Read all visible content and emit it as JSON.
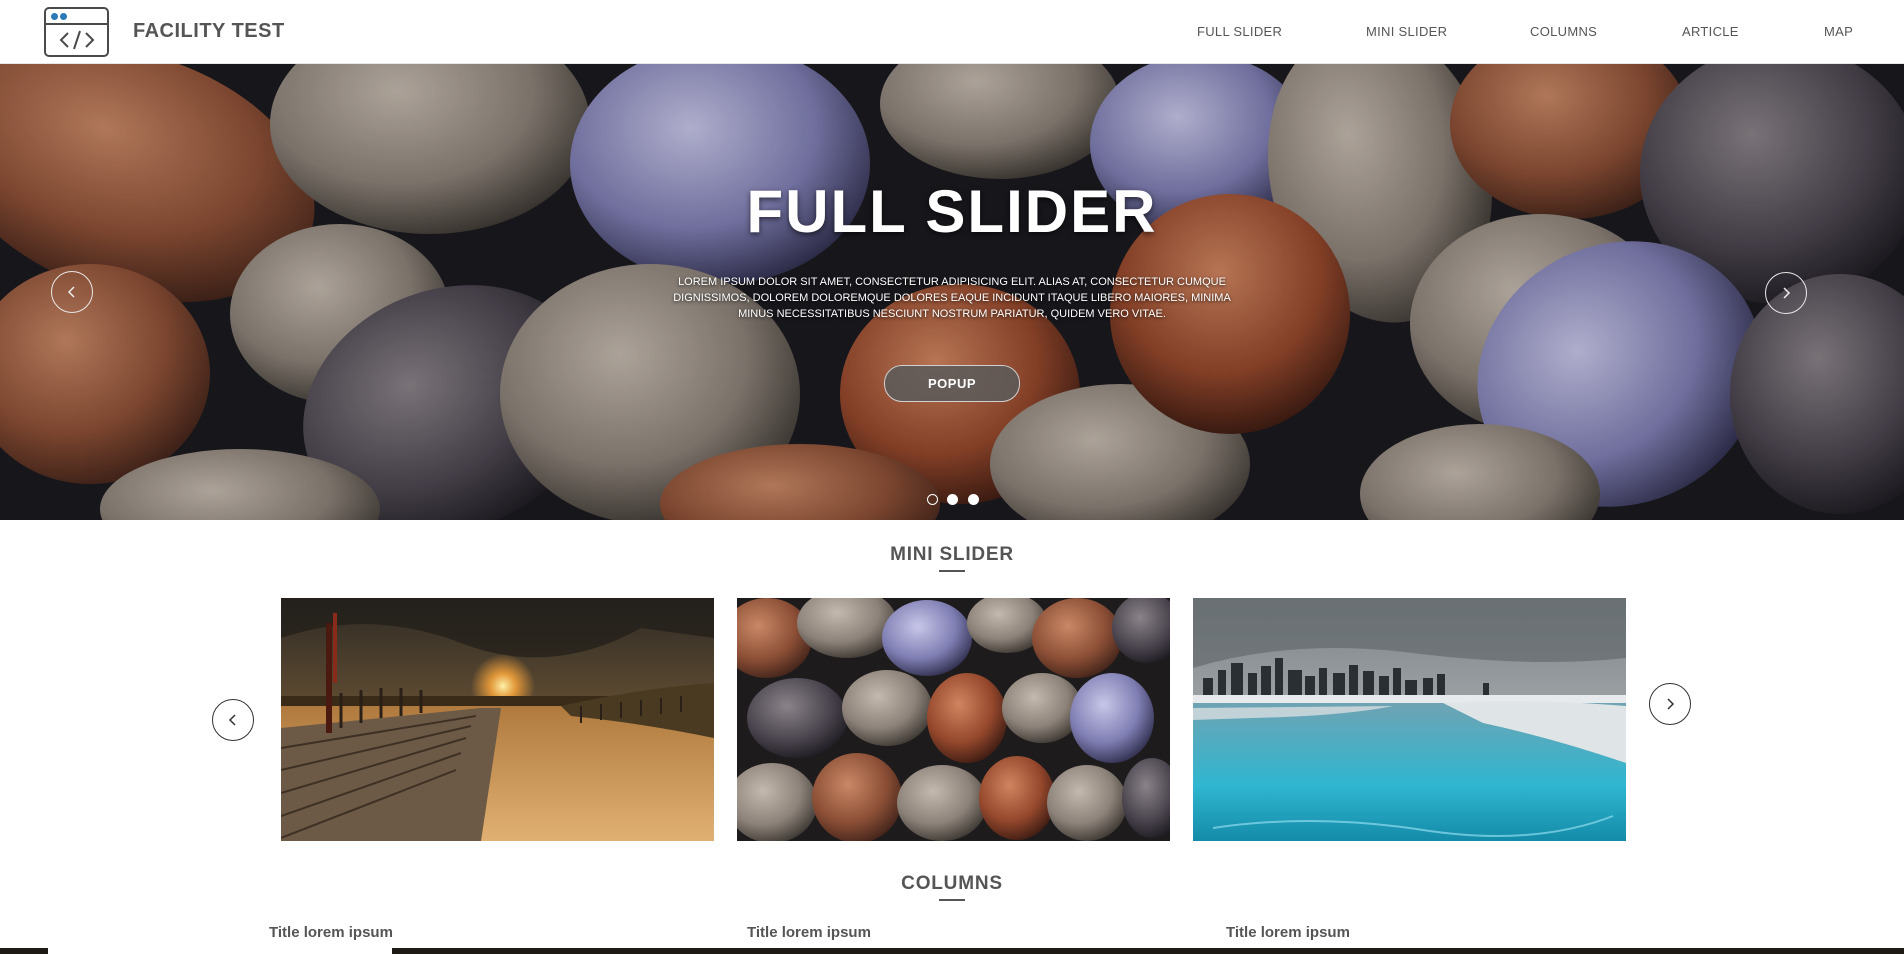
{
  "header": {
    "brand": "FACILITY TEST",
    "logo_icon": "code-window-icon",
    "nav": [
      {
        "label": "FULL SLIDER"
      },
      {
        "label": "MINI SLIDER"
      },
      {
        "label": "COLUMNS"
      },
      {
        "label": "ARTICLE"
      },
      {
        "label": "MAP"
      }
    ]
  },
  "hero": {
    "title": "FULL SLIDER",
    "text": "Lorem ipsum dolor sit amet, consectetur adipisicing elit. Alias at, consectetur cumque dignissimos, dolorem doloremque dolores eaque incidunt itaque libero maiores, minima minus necessitatibus nesciunt nostrum pariatur, quidem vero vitae.",
    "button": "POPUP",
    "prev_icon": "chevron-left-icon",
    "next_icon": "chevron-right-icon",
    "slide_count": 3,
    "active_slide": 1
  },
  "mini_slider": {
    "title": "MINI SLIDER",
    "images": [
      "beach-boardwalk-sunset",
      "river-stones",
      "frozen-lake-city-skyline"
    ],
    "prev_icon": "chevron-left-icon",
    "next_icon": "chevron-right-icon"
  },
  "columns": {
    "title": "COLUMNS",
    "items": [
      {
        "title": "Title lorem ipsum"
      },
      {
        "title": "Title lorem ipsum"
      },
      {
        "title": "Title lorem ipsum"
      }
    ]
  },
  "colors": {
    "text": "#555555",
    "logo_accent": "#2a7ab8",
    "white": "#ffffff"
  }
}
